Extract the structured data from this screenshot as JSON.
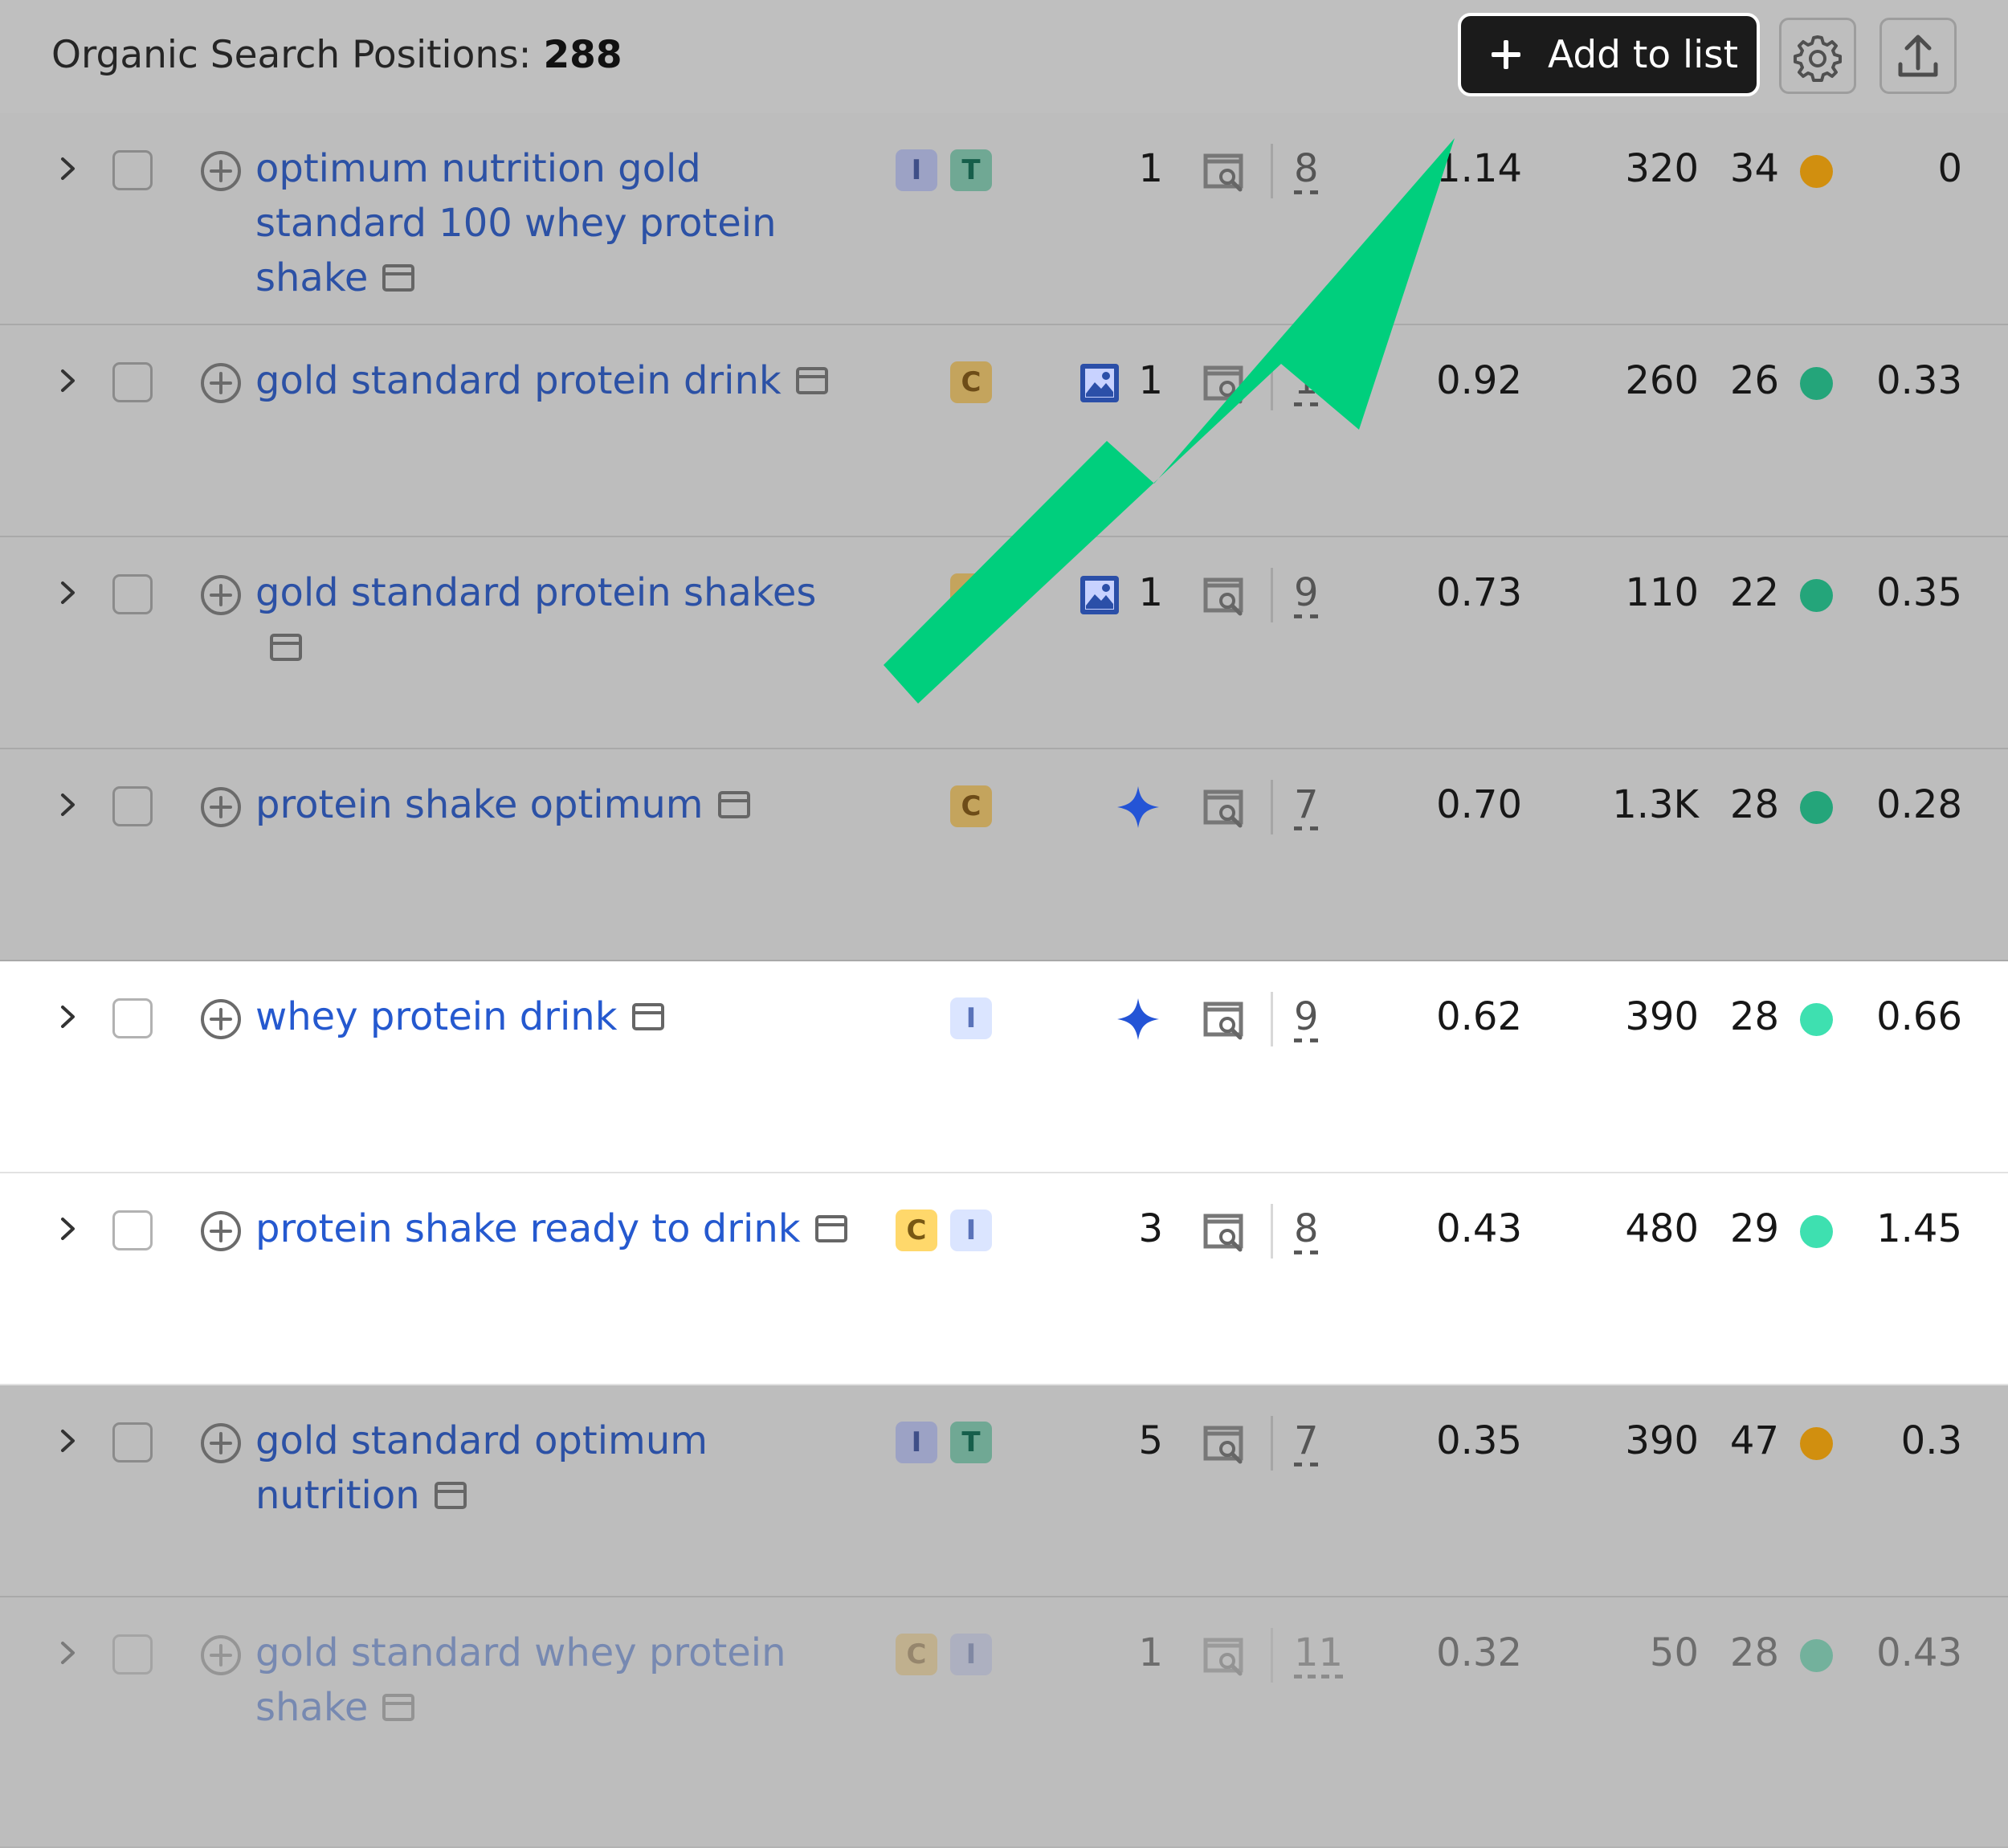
{
  "header": {
    "title_label": "Organic Search Positions:",
    "title_count": "288",
    "add_button_label": "Add to list",
    "settings_icon": "gear-icon",
    "export_icon": "export-icon"
  },
  "rows": [
    {
      "keyword": "optimum nutrition gold standard 100 whey protein shake",
      "intents": [
        "I",
        "T"
      ],
      "feature": "",
      "position": "1",
      "serp_count": "8",
      "cpc": "1.14",
      "volume": "320",
      "kd": "34",
      "kd_color": "#d18f0f",
      "result": "0",
      "white": false
    },
    {
      "keyword": "gold standard protein drink",
      "intents": [
        "C"
      ],
      "feature": "image",
      "position": "1",
      "serp_count": "1",
      "cpc": "0.92",
      "volume": "260",
      "kd": "26",
      "kd_color": "#24a57a",
      "result": "0.33",
      "white": false
    },
    {
      "keyword": "gold standard protein shakes",
      "intents": [
        "C"
      ],
      "feature": "image",
      "position": "1",
      "serp_count": "9",
      "cpc": "0.73",
      "volume": "110",
      "kd": "22",
      "kd_color": "#24a57a",
      "result": "0.35",
      "white": false
    },
    {
      "keyword": "protein shake optimum",
      "intents": [
        "C"
      ],
      "feature": "ai-star",
      "position": "",
      "serp_count": "7",
      "cpc": "0.70",
      "volume": "1.3K",
      "kd": "28",
      "kd_color": "#24a57a",
      "result": "0.28",
      "white": false
    },
    {
      "keyword": "whey protein drink",
      "intents": [
        "I"
      ],
      "feature": "ai-star",
      "position": "",
      "serp_count": "9",
      "cpc": "0.62",
      "volume": "390",
      "kd": "28",
      "kd_color": "#3ee0b0",
      "result": "0.66",
      "white": true
    },
    {
      "keyword": "protein shake ready to drink",
      "intents": [
        "C",
        "I"
      ],
      "feature": "",
      "position": "3",
      "serp_count": "8",
      "cpc": "0.43",
      "volume": "480",
      "kd": "29",
      "kd_color": "#3ee0b0",
      "result": "1.45",
      "white": true
    },
    {
      "keyword": "gold standard optimum nutrition",
      "intents": [
        "I",
        "T"
      ],
      "feature": "",
      "position": "5",
      "serp_count": "7",
      "cpc": "0.35",
      "volume": "390",
      "kd": "47",
      "kd_color": "#d18f0f",
      "result": "0.3",
      "white": false
    },
    {
      "keyword": "gold standard whey protein shake",
      "intents": [
        "C",
        "I"
      ],
      "feature": "",
      "position": "1",
      "serp_count": "11",
      "cpc": "0.32",
      "volume": "50",
      "kd": "28",
      "kd_color": "#24a57a",
      "result": "0.43",
      "white": false
    }
  ],
  "annotation": {
    "arrow_color": "#00cf7d"
  }
}
